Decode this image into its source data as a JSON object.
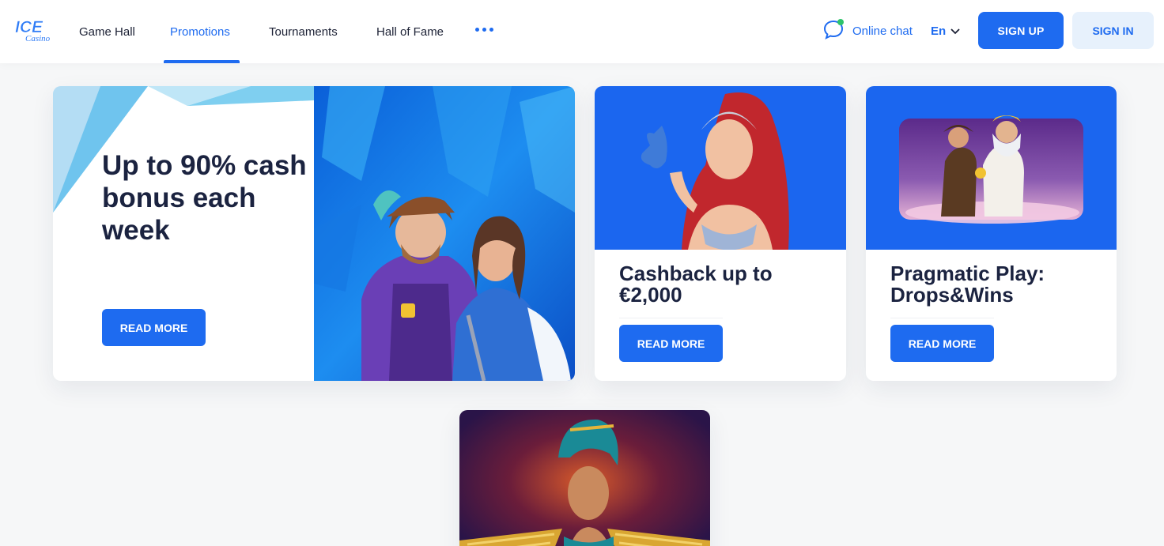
{
  "brand": {
    "logo_text": "ICE",
    "logo_sub": "Casino",
    "accent": "#1e6bf0"
  },
  "nav": {
    "items": [
      {
        "label": "Game Hall"
      },
      {
        "label": "Promotions",
        "active": true
      },
      {
        "label": "Tournaments"
      },
      {
        "label": "Hall of Fame"
      }
    ],
    "more_icon": "more-dots-icon"
  },
  "header": {
    "chat_label": "Online chat",
    "lang_label": "En",
    "signup_label": "SIGN UP",
    "signin_label": "SIGN IN"
  },
  "promotions": [
    {
      "title": "Up to 90% cash bonus each week",
      "button": "READ MORE"
    },
    {
      "title": "Cashback up to €2,000",
      "button": "READ MORE"
    },
    {
      "title": "Pragmatic Play: Drops&Wins",
      "button": "READ MORE"
    },
    {
      "title": "",
      "button": ""
    }
  ]
}
